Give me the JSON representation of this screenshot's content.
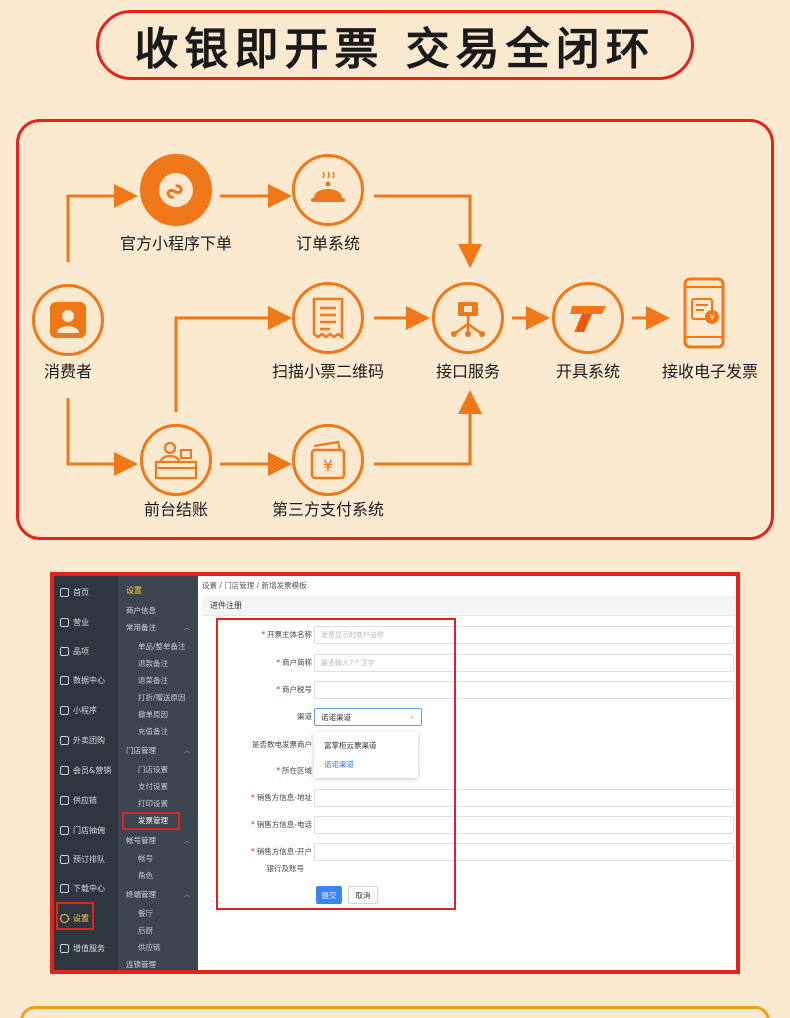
{
  "title": "收银即开票  交易全闭环",
  "colors": {
    "accent": "#f07818",
    "brand_red": "#e1251b",
    "background": "#fbe9d0"
  },
  "flow": {
    "nodes": {
      "consumer": {
        "label": "消费者",
        "icon": "person-icon"
      },
      "mini_program": {
        "label": "官方小程序下单",
        "icon": "mini-program-icon"
      },
      "order_system": {
        "label": "订单系统",
        "icon": "food-cloche-icon"
      },
      "scan_qr": {
        "label": "扫描小票二维码",
        "icon": "receipt-icon"
      },
      "interface": {
        "label": "接口服务",
        "icon": "network-hub-icon"
      },
      "invoice_system": {
        "label": "开具系统",
        "icon": "invoice-t-icon"
      },
      "receive_einvoice": {
        "label": "接收电子发票",
        "icon": "phone-invoice-icon"
      },
      "front_desk": {
        "label": "前台结账",
        "icon": "cashier-desk-icon"
      },
      "third_pay": {
        "label": "第三方支付系统",
        "icon": "wallet-yuan-icon"
      }
    }
  },
  "app": {
    "sidebar_main": [
      {
        "label": "首页",
        "icon": "home-icon"
      },
      {
        "label": "营业",
        "icon": "calendar-icon"
      },
      {
        "label": "品项",
        "icon": "bag-icon"
      },
      {
        "label": "数据中心",
        "icon": "share-icon"
      },
      {
        "label": "小程序",
        "icon": "mobile-icon"
      },
      {
        "label": "外卖团购",
        "icon": "bike-icon"
      },
      {
        "label": "会员&营销",
        "icon": "member-icon"
      },
      {
        "label": "供应链",
        "icon": "truck-icon"
      },
      {
        "label": "门店抽佣",
        "icon": "store-icon"
      },
      {
        "label": "预订排队",
        "icon": "clock-icon"
      },
      {
        "label": "下载中心",
        "icon": "download-icon"
      },
      {
        "label": "设置",
        "icon": "settings-icon"
      },
      {
        "label": "增值服务",
        "icon": "shield-icon"
      }
    ],
    "sidebar_sub": {
      "title": "设置",
      "items": [
        {
          "label": "商户信息",
          "kind": "group"
        },
        {
          "label": "常用备注",
          "kind": "group"
        },
        {
          "label": "单品/整单备注",
          "kind": "sub"
        },
        {
          "label": "退款备注",
          "kind": "sub"
        },
        {
          "label": "退菜备注",
          "kind": "sub"
        },
        {
          "label": "打折/赠送原因",
          "kind": "sub"
        },
        {
          "label": "撤单原因",
          "kind": "sub"
        },
        {
          "label": "充值备注",
          "kind": "sub"
        },
        {
          "label": "门店管理",
          "kind": "group"
        },
        {
          "label": "门店设置",
          "kind": "sub"
        },
        {
          "label": "支付设置",
          "kind": "sub"
        },
        {
          "label": "打印设置",
          "kind": "sub"
        },
        {
          "label": "发票管理",
          "kind": "sub"
        },
        {
          "label": "帐号管理",
          "kind": "group"
        },
        {
          "label": "帐号",
          "kind": "sub"
        },
        {
          "label": "角色",
          "kind": "sub"
        },
        {
          "label": "终端管理",
          "kind": "group"
        },
        {
          "label": "餐厅",
          "kind": "sub"
        },
        {
          "label": "后厨",
          "kind": "sub"
        },
        {
          "label": "供应链",
          "kind": "sub"
        },
        {
          "label": "连锁管理",
          "kind": "group"
        }
      ]
    },
    "breadcrumb": "设置  /  门店管理  /  新增发票模板",
    "section_title": "进件注册",
    "form": {
      "issuer_name": {
        "label": "开票主体名称",
        "placeholder": "发票显示的商户名称"
      },
      "short_name": {
        "label": "商户简称",
        "placeholder": "最多输入7个汉字"
      },
      "tax_no": {
        "label": "商户税号",
        "placeholder": ""
      },
      "channel": {
        "label": "渠道",
        "value": "诺诺渠道"
      },
      "is_einvoice_merchant": {
        "label": "是否数电发票商户"
      },
      "region": {
        "label": "所在区域"
      },
      "seller_address": {
        "label": "销售方信息-地址"
      },
      "seller_phone": {
        "label": "销售方信息-电话"
      },
      "seller_bank": {
        "label": "销售方信息-开户",
        "label2": "银行及账号"
      },
      "channel_options": [
        "富掌柜云票渠道",
        "诺诺渠道"
      ],
      "submit": "提交",
      "cancel": "取消"
    }
  }
}
